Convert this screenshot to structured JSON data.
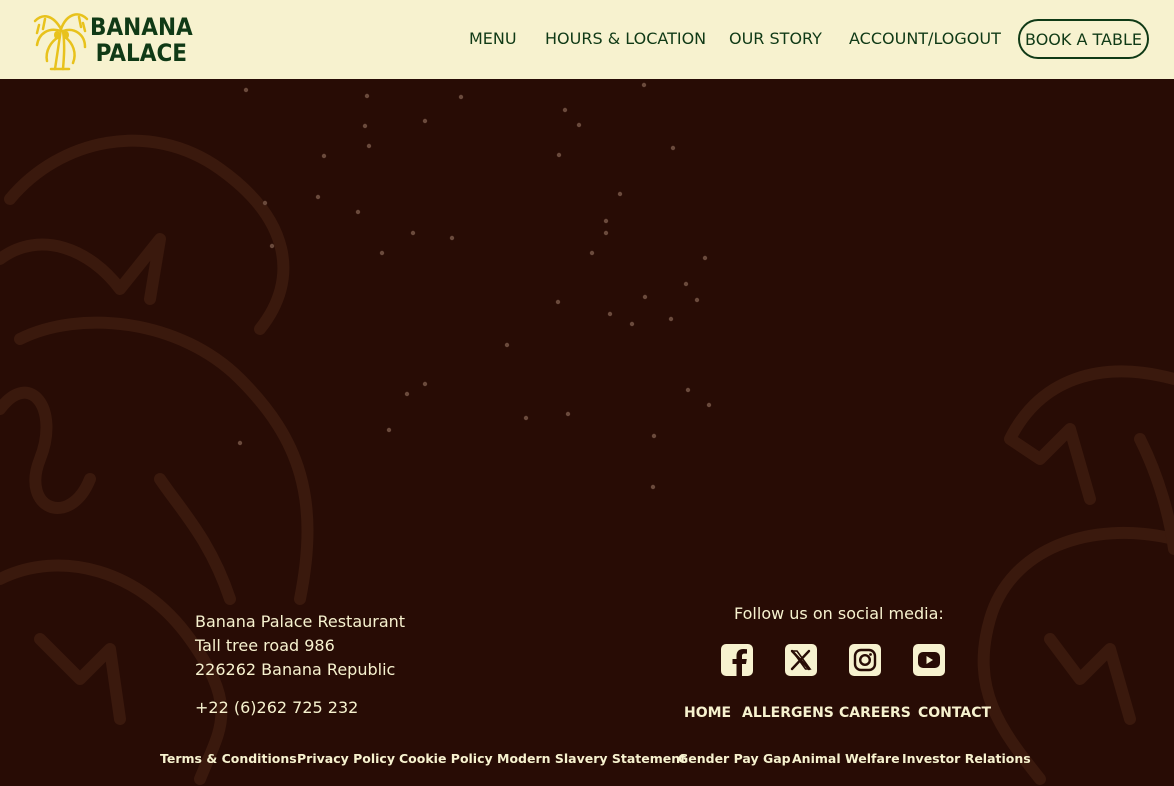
{
  "brand": {
    "line1": "BANANA",
    "line2": "PALACE",
    "logo_icon": "banana-tree-icon"
  },
  "nav": {
    "menu": "MENU",
    "hours_location": "HOURS & LOCATION",
    "our_story": "OUR STORY",
    "account": "ACCOUNT/LOGOUT",
    "book": "BOOK A TABLE"
  },
  "footer": {
    "address_name": "Banana Palace Restaurant",
    "address_street": "Tall tree road 986",
    "address_city": "226262 Banana Republic",
    "phone": "+22 (6)262 725 232",
    "follow_label": "Follow us on social media:",
    "social_icons": [
      "facebook-icon",
      "x-icon",
      "instagram-icon",
      "youtube-icon"
    ],
    "links": {
      "home": "HOME",
      "allergens": "ALLERGENS",
      "careers": "CAREERS",
      "contact": "CONTACT"
    },
    "legal": {
      "terms": "Terms & Conditions",
      "privacy": "Privacy Policy",
      "cookie": "Cookie Policy",
      "slavery": "Modern Slavery Statement",
      "gender": "Gender Pay Gap",
      "animal": "Animal Welfare",
      "investor": "Investor Relations"
    }
  },
  "colors": {
    "header_bg": "#f7f2cf",
    "header_text": "#103a16",
    "page_bg": "#280c05",
    "footer_text": "#f7f2cf",
    "logo_yellow": "#e8c21c"
  }
}
